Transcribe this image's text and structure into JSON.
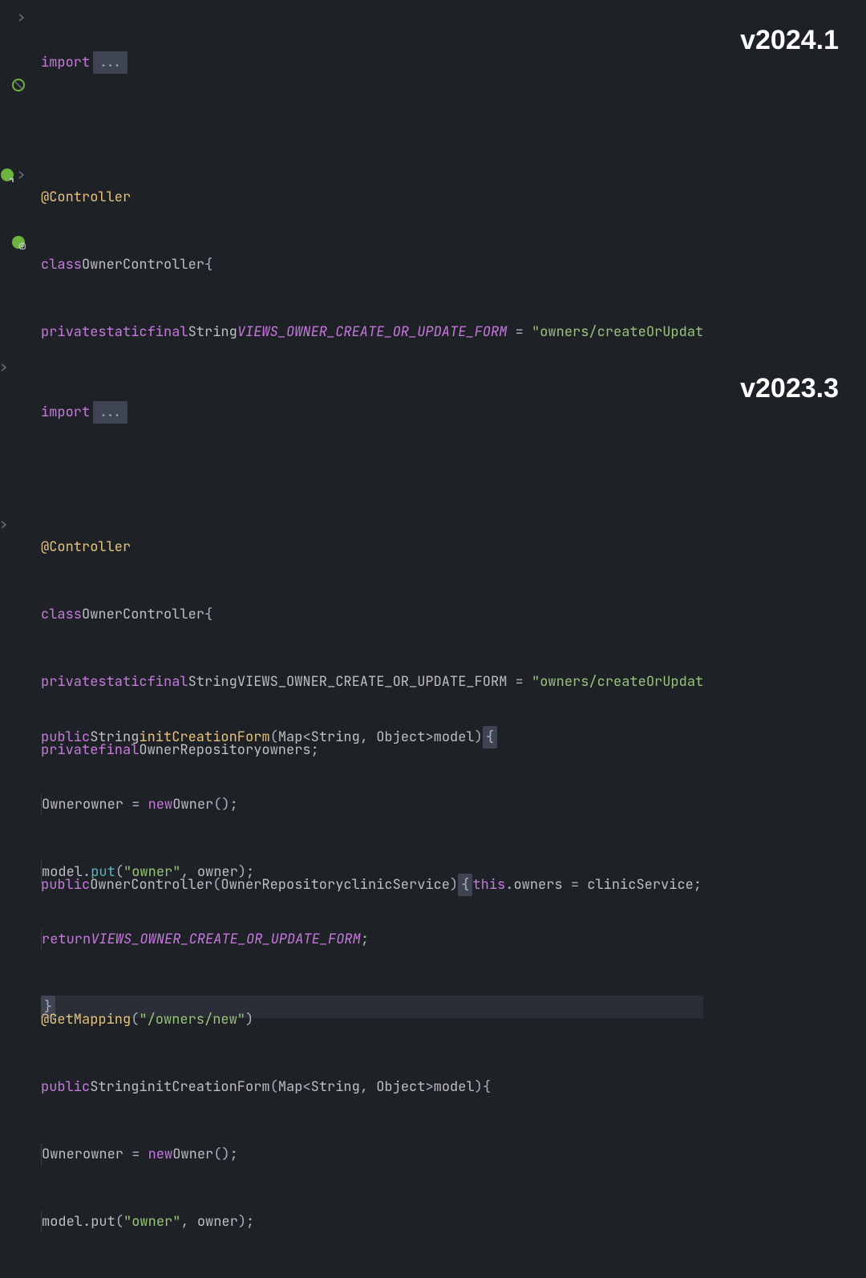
{
  "versionTop": "v2024.1",
  "versionBottom": "v2023.3",
  "importKeyword": "import",
  "foldedPlaceholder": "...",
  "annotationController": "@Controller",
  "classKeyword": "class",
  "className": "OwnerController",
  "openBrace": "{",
  "closeBrace": "}",
  "privateKw": "private",
  "staticKw": "static",
  "finalKw": "final",
  "stringType": "String",
  "constantName": "VIEWS_OWNER_CREATE_OR_UPDATE_FORM",
  "equals": " = ",
  "constantValue": "\"owners/createOrUpdat",
  "ownerRepoType": "OwnerRepository",
  "ownersField": "owners",
  "semicolon": ";",
  "publicKw": "public",
  "ctorName": "OwnerController",
  "ctorParamType": "OwnerRepository",
  "ctorParamName": "clinicService",
  "openParen": "(",
  "closeParen": ")",
  "thisKw": "this",
  "dot": ".",
  "getMappingAnn": "@GetMapping",
  "getMappingArg": "\"/owners/new\"",
  "initMethodName": "initCreationForm",
  "mapType": "Map",
  "lt": "<",
  "gt": ">",
  "objectType": "Object",
  "comma": ", ",
  "modelParam": "model",
  "ownerType": "Owner",
  "ownerVar": "owner",
  "newKw": "new",
  "parenPair": "()",
  "putMethod": "put",
  "ownerLiteral": "\"owner\"",
  "returnKw": "return"
}
